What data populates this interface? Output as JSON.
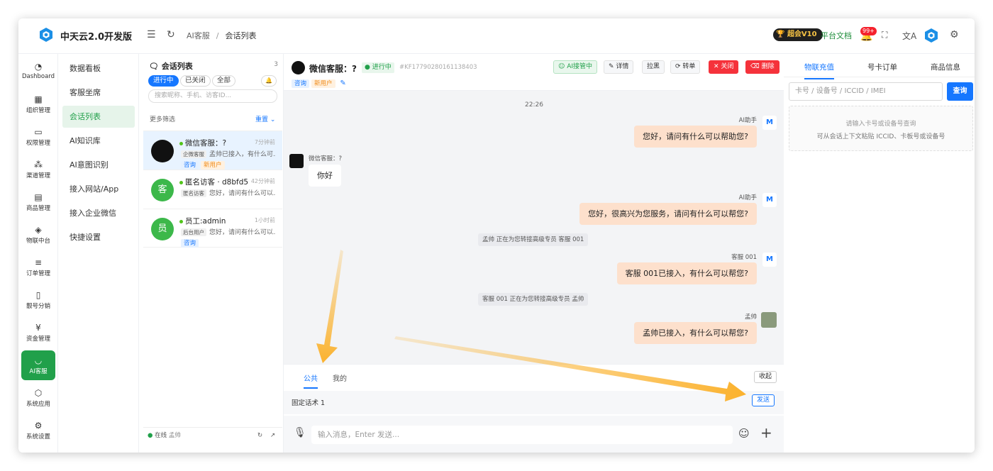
{
  "app": {
    "brand": "中天云2.0开发版",
    "vip": "超会V10",
    "docs": "平台文档",
    "notif_count": "99+"
  },
  "breadcrumb": [
    "AI客服",
    "会话列表"
  ],
  "nav_primary": [
    {
      "label": "Dashboard",
      "icon": "gauge-icon"
    },
    {
      "label": "组织管理",
      "icon": "grid-icon"
    },
    {
      "label": "权限管理",
      "icon": "monitor-icon"
    },
    {
      "label": "渠道管理",
      "icon": "network-icon"
    },
    {
      "label": "商品管理",
      "icon": "store-icon"
    },
    {
      "label": "物联中台",
      "icon": "cube-icon"
    },
    {
      "label": "订单管理",
      "icon": "list-icon"
    },
    {
      "label": "靓号分销",
      "icon": "phone-icon"
    },
    {
      "label": "资金管理",
      "icon": "yen-icon"
    },
    {
      "label": "AI客服",
      "icon": "chat-icon",
      "active": true
    },
    {
      "label": "系统应用",
      "icon": "box-icon"
    },
    {
      "label": "系统设置",
      "icon": "gear-icon"
    }
  ],
  "nav_secondary": [
    {
      "label": "数据看板"
    },
    {
      "label": "客服坐席"
    },
    {
      "label": "会话列表",
      "active": true
    },
    {
      "label": "AI知识库"
    },
    {
      "label": "AI意图识别"
    },
    {
      "label": "接入网站/App"
    },
    {
      "label": "接入企业微信"
    },
    {
      "label": "快捷设置"
    }
  ],
  "conversations": {
    "title": "会话列表",
    "count": "3",
    "filters": [
      "进行中",
      "已关闭",
      "全部"
    ],
    "search_placeholder": "搜索昵称、手机、访客ID...",
    "more_filter": "更多筛选",
    "reset": "重置",
    "items": [
      {
        "name": "微信客服：?",
        "time": "7分钟前",
        "source": "企微客服",
        "preview": "孟帅已接入，有什么可...",
        "tags": [
          "咨询",
          "新用户"
        ],
        "avatar": ""
      },
      {
        "name": "匿名访客 · d8bfd5",
        "time": "42分钟前",
        "source": "匿名访客",
        "preview": "您好，请问有什么可以...",
        "tags": [],
        "avatar": "客"
      },
      {
        "name": "员工:admin",
        "time": "1小时前",
        "source": "后台用户",
        "preview": "您好，请问有什么可以...",
        "tags": [
          "咨询"
        ],
        "avatar": "员"
      }
    ],
    "footer_status": "在线",
    "footer_user": "孟帅"
  },
  "chat": {
    "title": "微信客服：?",
    "status": "进行中",
    "id": "#KF17790280161138403",
    "tags": [
      "咨询",
      "新用户"
    ],
    "actions": [
      "AI接管中",
      "详情",
      "拉黑",
      "转单",
      "关闭",
      "删除"
    ],
    "time": "22:26",
    "messages": [
      {
        "sender": "AI助手",
        "text": "您好，请问有什么可以帮助您?"
      },
      {
        "sender": "微信客服：?",
        "text": "你好"
      },
      {
        "sender": "AI助手",
        "text": "您好，很高兴为您服务，请问有什么可以帮您?"
      },
      {
        "system": "孟帅 正在为您转接高级专员 客服 001"
      },
      {
        "sender": "客服 001",
        "text": "客服 001已接入，有什么可以帮您?"
      },
      {
        "system": "客服 001 正在为您转接高级专员 孟帅"
      },
      {
        "sender": "孟帅",
        "text": "孟帅已接入，有什么可以帮您?"
      }
    ],
    "quick_tabs": [
      "公共",
      "我的"
    ],
    "collapse": "收起",
    "quick_reply": "固定话术 1",
    "send": "发送",
    "input_placeholder": "输入消息，Enter 发送..."
  },
  "right_panel": {
    "tabs": [
      "物联充值",
      "号卡订单",
      "商品信息"
    ],
    "search_placeholder": "卡号 / 设备号 / ICCID / IMEI",
    "search_button": "查询",
    "empty_line1": "请输入卡号或设备号查询",
    "empty_line2": "可从会话上下文粘贴 ICCID、卡板号或设备号"
  },
  "colors": {
    "brand_green": "#21a04a",
    "primary_blue": "#1677ff",
    "arrow": "#fbb22e"
  }
}
